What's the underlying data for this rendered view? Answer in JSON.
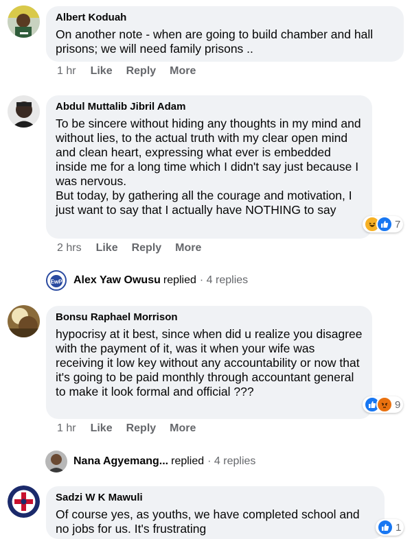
{
  "comments": [
    {
      "author": "Albert Koduah",
      "text": "On another note - when are going to build chamber and hall prisons; we will need family prisons ..",
      "time": "1 hr",
      "like": "Like",
      "reply": "Reply",
      "more": "More"
    },
    {
      "author": "Abdul Muttalib Jibril Adam",
      "text": "To be sincere without hiding any thoughts in my mind and without lies, to the actual truth with my clear open mind and clean heart, expressing what ever is embedded inside me for a long time which I didn't say just because I was nervous.\nBut today, by gathering all the courage and motivation, I just want to say that I actually have NOTHING to say",
      "time": "2 hrs",
      "like": "Like",
      "reply": "Reply",
      "more": "More",
      "reaction_count": "7",
      "reaction_icons": [
        "haha-icon",
        "like-icon"
      ]
    },
    {
      "author": "Bonsu Raphael Morrison",
      "text": "hypocrisy at it best, since when did u realize you disagree with the payment of it, was it when your wife was receiving it low key without any accountability or now that it's going to be paid monthly through accountant general to make it look formal and official ???",
      "time": "1 hr",
      "like": "Like",
      "reply": "Reply",
      "more": "More",
      "reaction_count": "9",
      "reaction_icons": [
        "like-icon",
        "angry-icon"
      ]
    },
    {
      "author": "Sadzi W K Mawuli",
      "text": "Of course yes, as youths, we have completed school and no jobs for us. It's frustrating",
      "reaction_count": "1",
      "reaction_icons": [
        "like-icon"
      ]
    }
  ],
  "reply_threads": [
    {
      "name": "Alex Yaw Owusu",
      "replied": "replied",
      "count": "· 4 replies"
    },
    {
      "name": "Nana Agyemang...",
      "replied": "replied",
      "count": "· 4 replies"
    }
  ],
  "colors": {
    "bubble": "#f0f2f5",
    "meta_text": "#65676b",
    "like_blue": "#1877f2",
    "haha_yellow": "#f7b125",
    "angry_orange": "#e9710f"
  }
}
